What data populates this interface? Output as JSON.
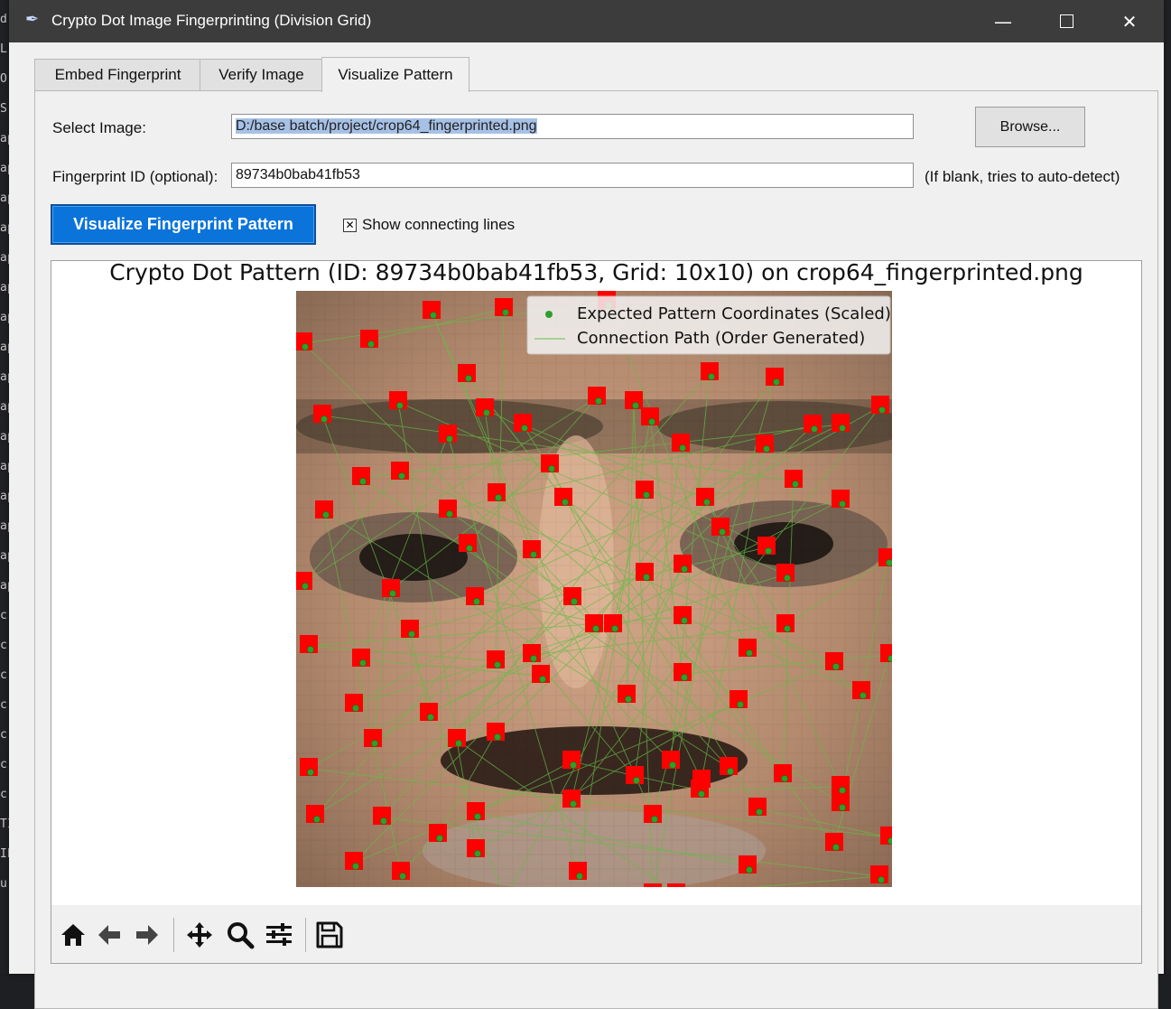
{
  "window": {
    "title": "Crypto Dot Image Fingerprinting (Division Grid)",
    "minimize_glyph": "—",
    "close_glyph": "✕"
  },
  "tabs": [
    {
      "label": "Embed Fingerprint"
    },
    {
      "label": "Verify Image"
    },
    {
      "label": "Visualize Pattern"
    }
  ],
  "form": {
    "select_image_label": "Select Image:",
    "image_path": "D:/base batch/project/crop64_fingerprinted.png",
    "browse_label": "Browse...",
    "fingerprint_label": "Fingerprint ID (optional):",
    "fingerprint_value": "89734b0bab41fb53",
    "fingerprint_hint": "(If blank, tries to auto-detect)",
    "visualize_button": "Visualize Fingerprint Pattern",
    "show_lines_checked": true,
    "show_lines_label": "Show connecting lines"
  },
  "figure": {
    "title": "Crypto Dot Pattern (ID: 89734b0bab41fb53, Grid: 10x10) on crop64_fingerprinted.png",
    "legend": [
      {
        "label": "Expected Pattern Coordinates (Scaled)",
        "color": "#2ca02c"
      },
      {
        "label": "Connection Path (Order Generated)",
        "color": "#66bb44"
      }
    ],
    "marker_color": "#ff0000"
  },
  "toolbar": [
    {
      "name": "home-icon"
    },
    {
      "name": "back-icon"
    },
    {
      "name": "forward-icon"
    },
    {
      "name": "pan-icon"
    },
    {
      "name": "zoom-icon"
    },
    {
      "name": "configure-icon"
    },
    {
      "name": "save-icon"
    }
  ],
  "background_editor": {
    "left_glyphs": [
      "d",
      "L",
      "O.",
      "S.",
      "ap",
      "ap",
      "ap",
      "ap",
      "ap",
      "ap",
      "ap",
      "ap",
      "ap",
      "ap",
      "ap",
      "ap",
      "ap",
      "ap",
      "ap",
      "ap",
      "cr",
      "cr",
      "cr",
      "cr",
      "cr",
      "cr",
      "cr",
      "TI",
      "IE",
      "u"
    ]
  }
}
